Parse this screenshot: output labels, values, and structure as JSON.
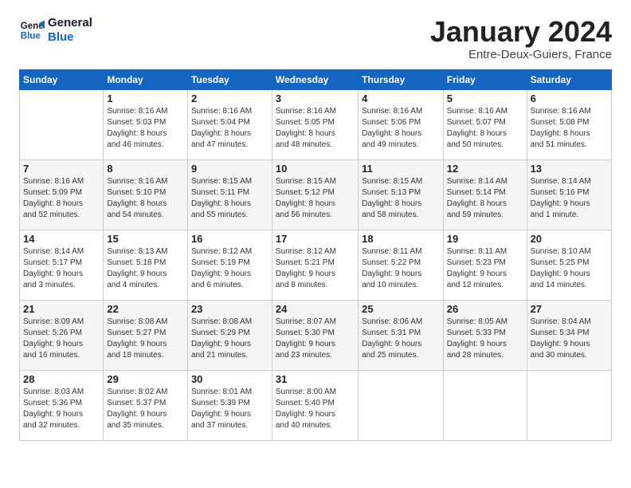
{
  "logo": {
    "line1": "General",
    "line2": "Blue"
  },
  "title": "January 2024",
  "subtitle": "Entre-Deux-Guiers, France",
  "days_header": [
    "Sunday",
    "Monday",
    "Tuesday",
    "Wednesday",
    "Thursday",
    "Friday",
    "Saturday"
  ],
  "weeks": [
    [
      {
        "day": "",
        "info": ""
      },
      {
        "day": "1",
        "info": "Sunrise: 8:16 AM\nSunset: 5:03 PM\nDaylight: 8 hours\nand 46 minutes."
      },
      {
        "day": "2",
        "info": "Sunrise: 8:16 AM\nSunset: 5:04 PM\nDaylight: 8 hours\nand 47 minutes."
      },
      {
        "day": "3",
        "info": "Sunrise: 8:16 AM\nSunset: 5:05 PM\nDaylight: 8 hours\nand 48 minutes."
      },
      {
        "day": "4",
        "info": "Sunrise: 8:16 AM\nSunset: 5:06 PM\nDaylight: 8 hours\nand 49 minutes."
      },
      {
        "day": "5",
        "info": "Sunrise: 8:16 AM\nSunset: 5:07 PM\nDaylight: 8 hours\nand 50 minutes."
      },
      {
        "day": "6",
        "info": "Sunrise: 8:16 AM\nSunset: 5:08 PM\nDaylight: 8 hours\nand 51 minutes."
      }
    ],
    [
      {
        "day": "7",
        "info": "Sunrise: 8:16 AM\nSunset: 5:09 PM\nDaylight: 8 hours\nand 52 minutes."
      },
      {
        "day": "8",
        "info": "Sunrise: 8:16 AM\nSunset: 5:10 PM\nDaylight: 8 hours\nand 54 minutes."
      },
      {
        "day": "9",
        "info": "Sunrise: 8:15 AM\nSunset: 5:11 PM\nDaylight: 8 hours\nand 55 minutes."
      },
      {
        "day": "10",
        "info": "Sunrise: 8:15 AM\nSunset: 5:12 PM\nDaylight: 8 hours\nand 56 minutes."
      },
      {
        "day": "11",
        "info": "Sunrise: 8:15 AM\nSunset: 5:13 PM\nDaylight: 8 hours\nand 58 minutes."
      },
      {
        "day": "12",
        "info": "Sunrise: 8:14 AM\nSunset: 5:14 PM\nDaylight: 8 hours\nand 59 minutes."
      },
      {
        "day": "13",
        "info": "Sunrise: 8:14 AM\nSunset: 5:16 PM\nDaylight: 9 hours\nand 1 minute."
      }
    ],
    [
      {
        "day": "14",
        "info": "Sunrise: 8:14 AM\nSunset: 5:17 PM\nDaylight: 9 hours\nand 3 minutes."
      },
      {
        "day": "15",
        "info": "Sunrise: 8:13 AM\nSunset: 5:18 PM\nDaylight: 9 hours\nand 4 minutes."
      },
      {
        "day": "16",
        "info": "Sunrise: 8:12 AM\nSunset: 5:19 PM\nDaylight: 9 hours\nand 6 minutes."
      },
      {
        "day": "17",
        "info": "Sunrise: 8:12 AM\nSunset: 5:21 PM\nDaylight: 9 hours\nand 8 minutes."
      },
      {
        "day": "18",
        "info": "Sunrise: 8:11 AM\nSunset: 5:22 PM\nDaylight: 9 hours\nand 10 minutes."
      },
      {
        "day": "19",
        "info": "Sunrise: 8:11 AM\nSunset: 5:23 PM\nDaylight: 9 hours\nand 12 minutes."
      },
      {
        "day": "20",
        "info": "Sunrise: 8:10 AM\nSunset: 5:25 PM\nDaylight: 9 hours\nand 14 minutes."
      }
    ],
    [
      {
        "day": "21",
        "info": "Sunrise: 8:09 AM\nSunset: 5:26 PM\nDaylight: 9 hours\nand 16 minutes."
      },
      {
        "day": "22",
        "info": "Sunrise: 8:08 AM\nSunset: 5:27 PM\nDaylight: 9 hours\nand 18 minutes."
      },
      {
        "day": "23",
        "info": "Sunrise: 8:08 AM\nSunset: 5:29 PM\nDaylight: 9 hours\nand 21 minutes."
      },
      {
        "day": "24",
        "info": "Sunrise: 8:07 AM\nSunset: 5:30 PM\nDaylight: 9 hours\nand 23 minutes."
      },
      {
        "day": "25",
        "info": "Sunrise: 8:06 AM\nSunset: 5:31 PM\nDaylight: 9 hours\nand 25 minutes."
      },
      {
        "day": "26",
        "info": "Sunrise: 8:05 AM\nSunset: 5:33 PM\nDaylight: 9 hours\nand 28 minutes."
      },
      {
        "day": "27",
        "info": "Sunrise: 8:04 AM\nSunset: 5:34 PM\nDaylight: 9 hours\nand 30 minutes."
      }
    ],
    [
      {
        "day": "28",
        "info": "Sunrise: 8:03 AM\nSunset: 5:36 PM\nDaylight: 9 hours\nand 32 minutes."
      },
      {
        "day": "29",
        "info": "Sunrise: 8:02 AM\nSunset: 5:37 PM\nDaylight: 9 hours\nand 35 minutes."
      },
      {
        "day": "30",
        "info": "Sunrise: 8:01 AM\nSunset: 5:39 PM\nDaylight: 9 hours\nand 37 minutes."
      },
      {
        "day": "31",
        "info": "Sunrise: 8:00 AM\nSunset: 5:40 PM\nDaylight: 9 hours\nand 40 minutes."
      },
      {
        "day": "",
        "info": ""
      },
      {
        "day": "",
        "info": ""
      },
      {
        "day": "",
        "info": ""
      }
    ]
  ]
}
